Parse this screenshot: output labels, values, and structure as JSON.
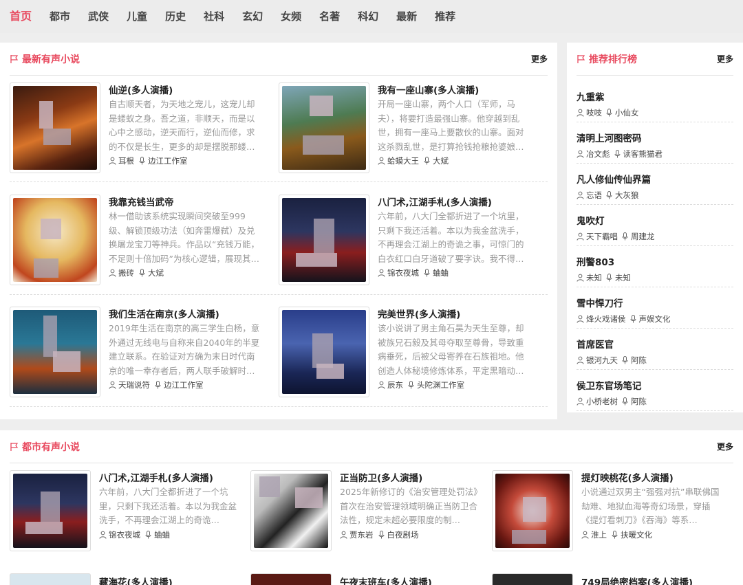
{
  "nav": {
    "items": [
      "首页",
      "都市",
      "武侠",
      "儿童",
      "历史",
      "社科",
      "玄幻",
      "女频",
      "名著",
      "科幻",
      "最新",
      "推荐"
    ]
  },
  "latest": {
    "title": "最新有声小说",
    "more": "更多",
    "books": [
      {
        "title": "仙逆(多人演播)",
        "desc": "自古顺天者，为天地之宠儿，这宠儿却是蝼蚁之身。吾之道，非顺天，而是以心中之感动，逆天而行，逆仙而修，求的不仅是长生，更多的却是摆脱那蝼…",
        "author": "耳根",
        "narrator": "边江工作室"
      },
      {
        "title": "我有一座山寨(多人演播)",
        "desc": "开局一座山寨，两个人口（军师，马夫），将要打造最强山寨。他穿越到乱世，拥有一座马上要散伙的山寨。面对这杀戮乱世，是打算抢钱抢粮抢婆娘…",
        "author": "蛤蟆大王",
        "narrator": "大斌"
      },
      {
        "title": "我靠充钱当武帝",
        "desc": "林一借助该系统实现瞬间突破至999级、解锁顶级功法（如奔雷爆弑）及兑换屠龙宝刀等神兵。作品以“充钱万能，不足则十倍加码”为核心逻辑，展现其…",
        "author": "搬砖",
        "narrator": "大斌"
      },
      {
        "title": "八门术,江湖手札(多人演播)",
        "desc": "六年前，八大门全都折进了一个坑里，只剩下我还活着。本以为我金盆洗手，不再理会江湖上的奇诡之事，可惊门的白衣红口白牙道破了要字诀。我不得…",
        "author": "锦衣夜城",
        "narrator": "蛐蛐"
      },
      {
        "title": "我们生活在南京(多人演播)",
        "desc": "2019年生活在南京的高三学生白杨，意外通过无线电与自称来自2040年的半夏建立联系。在验证对方确为末日时代南京的唯一幸存者后，两人联手破解时…",
        "author": "天瑞说符",
        "narrator": "边江工作室"
      },
      {
        "title": "完美世界(多人演播)",
        "desc": "该小说讲了男主角石昊为天生至尊，却被族兄石毅及其母夺取至尊骨，导致重病垂死，后被父母寄养在石族祖地。他创造人体秘境修炼体系，平定黑暗动…",
        "author": "辰东",
        "narrator": "头陀渊工作室"
      }
    ]
  },
  "ranking": {
    "title": "推荐排行榜",
    "more": "更多",
    "items": [
      {
        "title": "九重紫",
        "author": "吱吱",
        "narrator": "小仙女"
      },
      {
        "title": "清明上河图密码",
        "author": "冶文彪",
        "narrator": "读客熊猫君"
      },
      {
        "title": "凡人修仙传仙界篇",
        "author": "忘语",
        "narrator": "大灰狼"
      },
      {
        "title": "鬼吹灯",
        "author": "天下霸唱",
        "narrator": "周建龙"
      },
      {
        "title": "刑警803",
        "author": "未知",
        "narrator": "未知"
      },
      {
        "title": "雪中悍刀行",
        "author": "烽火戏诸侯",
        "narrator": "声娱文化"
      },
      {
        "title": "首席医官",
        "author": "银河九天",
        "narrator": "阿陈"
      },
      {
        "title": "侯卫东官场笔记",
        "author": "小桥老树",
        "narrator": "阿陈"
      }
    ]
  },
  "urban": {
    "title": "都市有声小说",
    "more": "更多",
    "books": [
      {
        "title": "八门术,江湖手札(多人演播)",
        "desc": "六年前，八大门全都折进了一个坑里，只剩下我还活着。本以为我金盆洗手，不再理会江湖上的奇诡…",
        "author": "锦衣夜城",
        "narrator": "蛐蛐"
      },
      {
        "title": "正当防卫(多人演播)",
        "desc": "2025年新修订的《治安管理处罚法》首次在治安管理领域明确正当防卫合法性，规定未超必要限度的制…",
        "author": "贾东岩",
        "narrator": "白夜剧场"
      },
      {
        "title": "提灯映桃花(多人演播)",
        "desc": "小说通过双男主“强强对抗”串联佛国劫难、地狱血海等奇幻场景，穿插《提灯看刺刀》《吞海》等系…",
        "author": "淮上",
        "narrator": "扶暖文化"
      },
      {
        "title": "藏海花(多人演播)",
        "desc": "",
        "author": "",
        "narrator": ""
      },
      {
        "title": "午夜末班车(多人演播)",
        "desc": "",
        "author": "",
        "narrator": ""
      },
      {
        "title": "749局绝密档案(多人演播)",
        "desc": "",
        "author": "",
        "narrator": ""
      }
    ]
  },
  "colors": {
    "accent": "#e8495e",
    "muted": "#999999"
  }
}
